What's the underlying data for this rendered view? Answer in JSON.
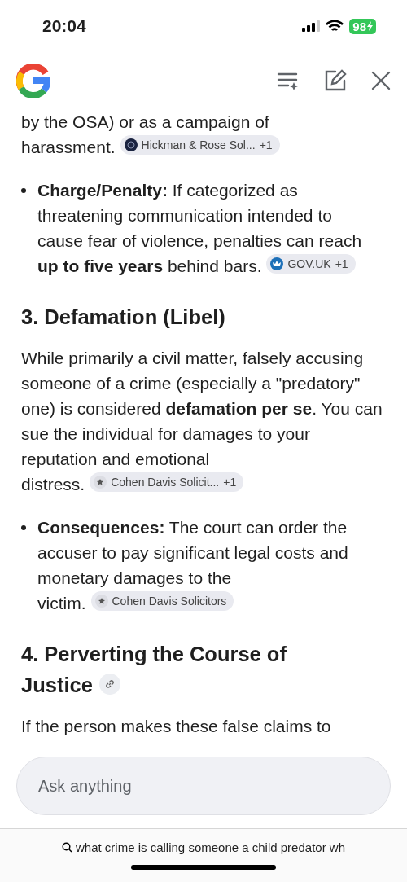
{
  "status_bar": {
    "time": "20:04",
    "battery": "98"
  },
  "header": {
    "actions": [
      {
        "kind": "sparkle-list"
      },
      {
        "kind": "edit"
      },
      {
        "kind": "close"
      }
    ]
  },
  "blocks": [
    {
      "kind": "paragraph",
      "text": "by the OSA) or as a campaign of",
      "tail": "harassment.",
      "citation": {
        "label": "Hickman & Rose Sol...",
        "more": "+1"
      }
    },
    {
      "kind": "bullet",
      "text": "**Charge/Penalty:** If categorized as threatening communication intended to cause fear of violence, penalties can reach",
      "tail": "**up to five years** behind bars.",
      "citation": {
        "label": "GOV.UK",
        "more": "+1"
      }
    },
    {
      "kind": "heading",
      "text": "3. Defamation (Libel)"
    },
    {
      "kind": "paragraph",
      "text": "While primarily a civil matter, falsely accusing someone of a crime (especially a \"predatory\" one) is considered **defamation per se**. You can sue the individual for damages to your reputation and emotional",
      "tail": "distress.",
      "citation": {
        "label": "Cohen Davis Solicit...",
        "more": "+1"
      }
    },
    {
      "kind": "bullet",
      "text": "**Consequences:** The court can order the accuser to pay significant legal costs and monetary damages to the",
      "tail": "victim.",
      "citation": {
        "label": "Cohen Davis Solicitors"
      }
    },
    {
      "kind": "heading",
      "text": "4. Perverting the Course of",
      "tail": "Justice",
      "link": true
    },
    {
      "kind": "paragraph",
      "text": "If the person makes these false claims to"
    }
  ],
  "ask": {
    "placeholder": "Ask anything"
  },
  "query": "what crime is calling someone a child predator wh"
}
